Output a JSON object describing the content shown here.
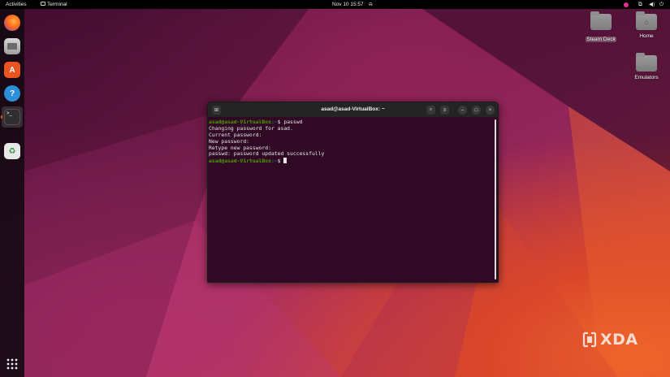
{
  "topbar": {
    "activities": "Activities",
    "app_name": "Terminal",
    "datetime": "Nov 10  15:57"
  },
  "dock": {
    "items": [
      "firefox-icon",
      "files-icon",
      "software-icon",
      "help-icon",
      "terminal-icon",
      "trash-icon"
    ],
    "apps_grid": "show-apps-icon"
  },
  "desktop": {
    "icons": [
      {
        "label": "Steam Deck"
      },
      {
        "label": "Home"
      },
      {
        "label": "Emulators"
      }
    ]
  },
  "terminal": {
    "title": "asad@asad-VirtualBox: ~",
    "prompt_user": "asad@asad-VirtualBox",
    "prompt_path": ":~",
    "prompt_symbol": "$ ",
    "command": "passwd",
    "output": [
      "Changing password for asad.",
      "Current password:",
      "New password:",
      "Retype new password:",
      "passwd: password updated successfully"
    ]
  },
  "watermark": {
    "brand": "XDA"
  },
  "colors": {
    "terminal_bg": "#300a24",
    "prompt_user": "#4e9a06",
    "prompt_path": "#3465a4",
    "topbar_bg": "#000000"
  }
}
